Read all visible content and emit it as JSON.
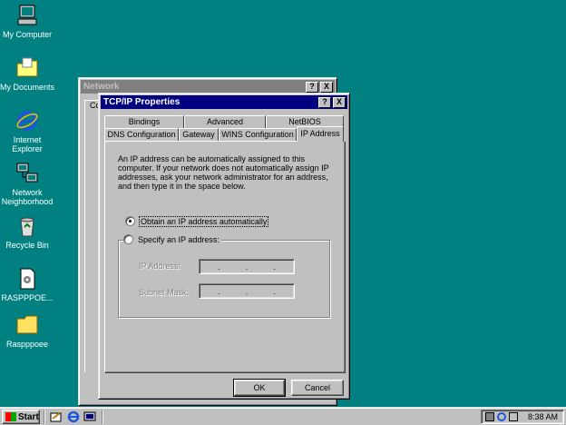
{
  "desktop": {
    "icons": [
      {
        "label": "My Computer",
        "icon": "my-computer-icon"
      },
      {
        "label": "My Documents",
        "icon": "folder-icon"
      },
      {
        "label": "Internet Explorer",
        "icon": "internet-explorer-icon"
      },
      {
        "label": "Network Neighborhood",
        "icon": "network-icon"
      },
      {
        "label": "Recycle Bin",
        "icon": "recycle-bin-icon"
      },
      {
        "label": "RASPPPOE...",
        "icon": "file-icon"
      },
      {
        "label": "Raspppoee",
        "icon": "folder-icon"
      }
    ]
  },
  "network_window": {
    "title": "Network",
    "tab_stub": "Co",
    "help_btn": "?",
    "close_btn": "X"
  },
  "tcpip_dialog": {
    "title": "TCP/IP Properties",
    "help_btn": "?",
    "close_btn": "X",
    "tabs_row1": [
      "Bindings",
      "Advanced",
      "NetBIOS"
    ],
    "tabs_row2": [
      "DNS Configuration",
      "Gateway",
      "WINS Configuration",
      "IP Address"
    ],
    "selected_tab": "IP Address",
    "description": "An IP address can be automatically assigned to this computer. If your network does not automatically assign IP addresses, ask your network administrator for an address, and then type it in the space below.",
    "radio_auto": "Obtain an IP address automatically",
    "radio_specify": "Specify an IP address:",
    "radio_selected": "auto",
    "ip_label": "IP Address:",
    "subnet_label": "Subnet Mask:",
    "ip_dot": ".",
    "ok_label": "OK",
    "cancel_label": "Cancel"
  },
  "taskbar": {
    "start_label": "Start",
    "clock": "8:38 AM"
  },
  "colors": {
    "desktop": "#008080",
    "titlebar_active": "#000080",
    "titlebar_inactive": "#808080",
    "face": "#c0c0c0"
  }
}
